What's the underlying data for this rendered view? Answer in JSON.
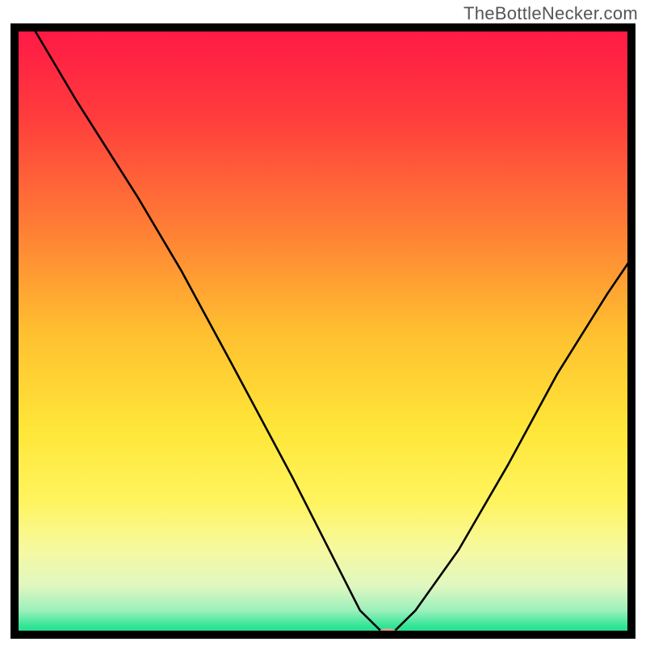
{
  "watermark": "TheBottleNecker.com",
  "chart_data": {
    "type": "line",
    "title": "",
    "xlabel": "",
    "ylabel": "",
    "xlim": [
      0,
      100
    ],
    "ylim": [
      0,
      100
    ],
    "series": [
      {
        "name": "bottleneck-curve",
        "x": [
          3,
          10,
          20,
          27,
          35,
          45,
          53,
          56,
          60,
          61,
          65,
          72,
          80,
          88,
          96,
          100
        ],
        "values": [
          100,
          88,
          72,
          60,
          45,
          26,
          10,
          4,
          0,
          0,
          4,
          14,
          28,
          43,
          56,
          62
        ]
      }
    ],
    "marker": {
      "x": 60.5,
      "y": 0,
      "rx": 1.8,
      "ry": 1.0,
      "color": "#f4968a"
    },
    "min_plateau": {
      "x0": 56,
      "x1": 61
    },
    "gradient": {
      "stops": [
        {
          "offset": 0.0,
          "color": "#ff1846"
        },
        {
          "offset": 0.14,
          "color": "#ff3a3d"
        },
        {
          "offset": 0.32,
          "color": "#ff7a35"
        },
        {
          "offset": 0.5,
          "color": "#ffbf30"
        },
        {
          "offset": 0.66,
          "color": "#ffe638"
        },
        {
          "offset": 0.78,
          "color": "#fff45e"
        },
        {
          "offset": 0.86,
          "color": "#f6f9a0"
        },
        {
          "offset": 0.92,
          "color": "#dff7c0"
        },
        {
          "offset": 0.96,
          "color": "#9df0bc"
        },
        {
          "offset": 0.985,
          "color": "#35e597"
        },
        {
          "offset": 1.0,
          "color": "#18df8d"
        }
      ]
    }
  }
}
